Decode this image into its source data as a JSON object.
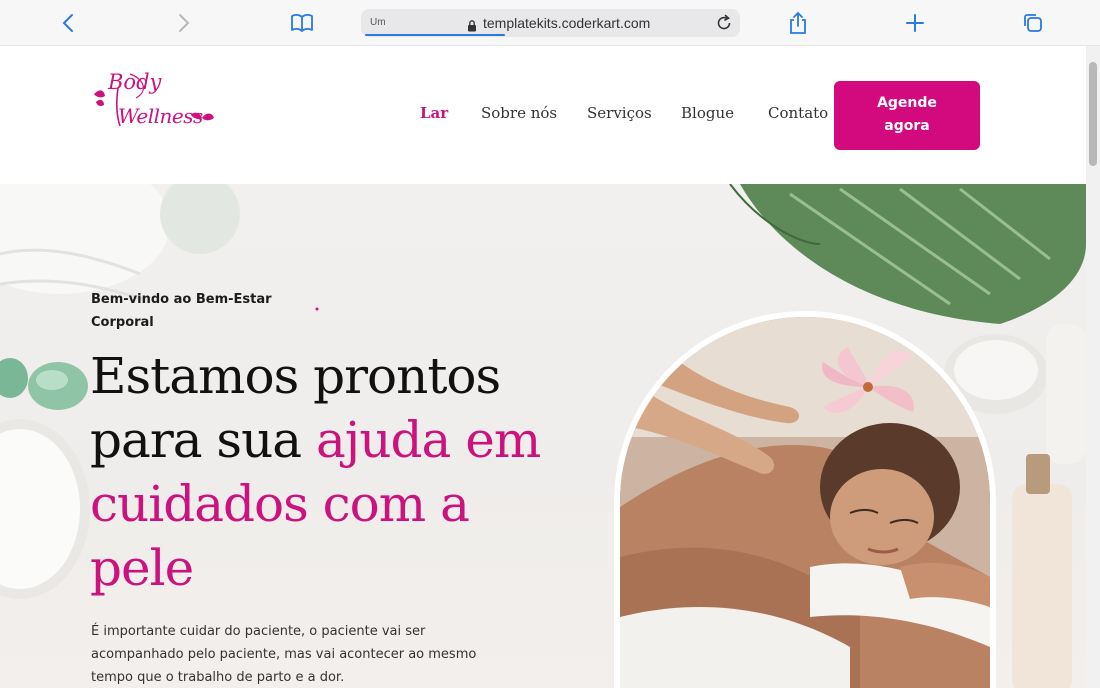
{
  "browser": {
    "reader_label": "Um",
    "url": "templatekits.coderkart.com"
  },
  "logo": {
    "line1": "Body",
    "line2": "Wellness"
  },
  "nav": {
    "items": [
      {
        "label": "Lar",
        "active": true
      },
      {
        "label": "Sobre nós",
        "active": false
      },
      {
        "label": "Serviços",
        "active": false
      },
      {
        "label": "Blogue",
        "active": false
      },
      {
        "label": "Contato",
        "active": false
      }
    ],
    "cta_line1": "Agende",
    "cta_line2": "agora"
  },
  "hero": {
    "welcome_line1": "Bem-vindo ao Bem-Estar",
    "welcome_line2": "Corporal",
    "headline_black1": "Estamos prontos",
    "headline_black2": "para sua ",
    "headline_pink1": "ajuda em",
    "headline_pink2": "cuidados com a",
    "headline_pink3": "pele",
    "description": "É importante cuidar do paciente, o paciente vai ser acompanhado pelo paciente, mas vai acontecer ao mesmo tempo que o trabalho de parto e a dor."
  },
  "colors": {
    "brand_pink": "#cc127e",
    "cta_pink": "#d20a7e",
    "leaf_green": "#5e8a5a"
  }
}
